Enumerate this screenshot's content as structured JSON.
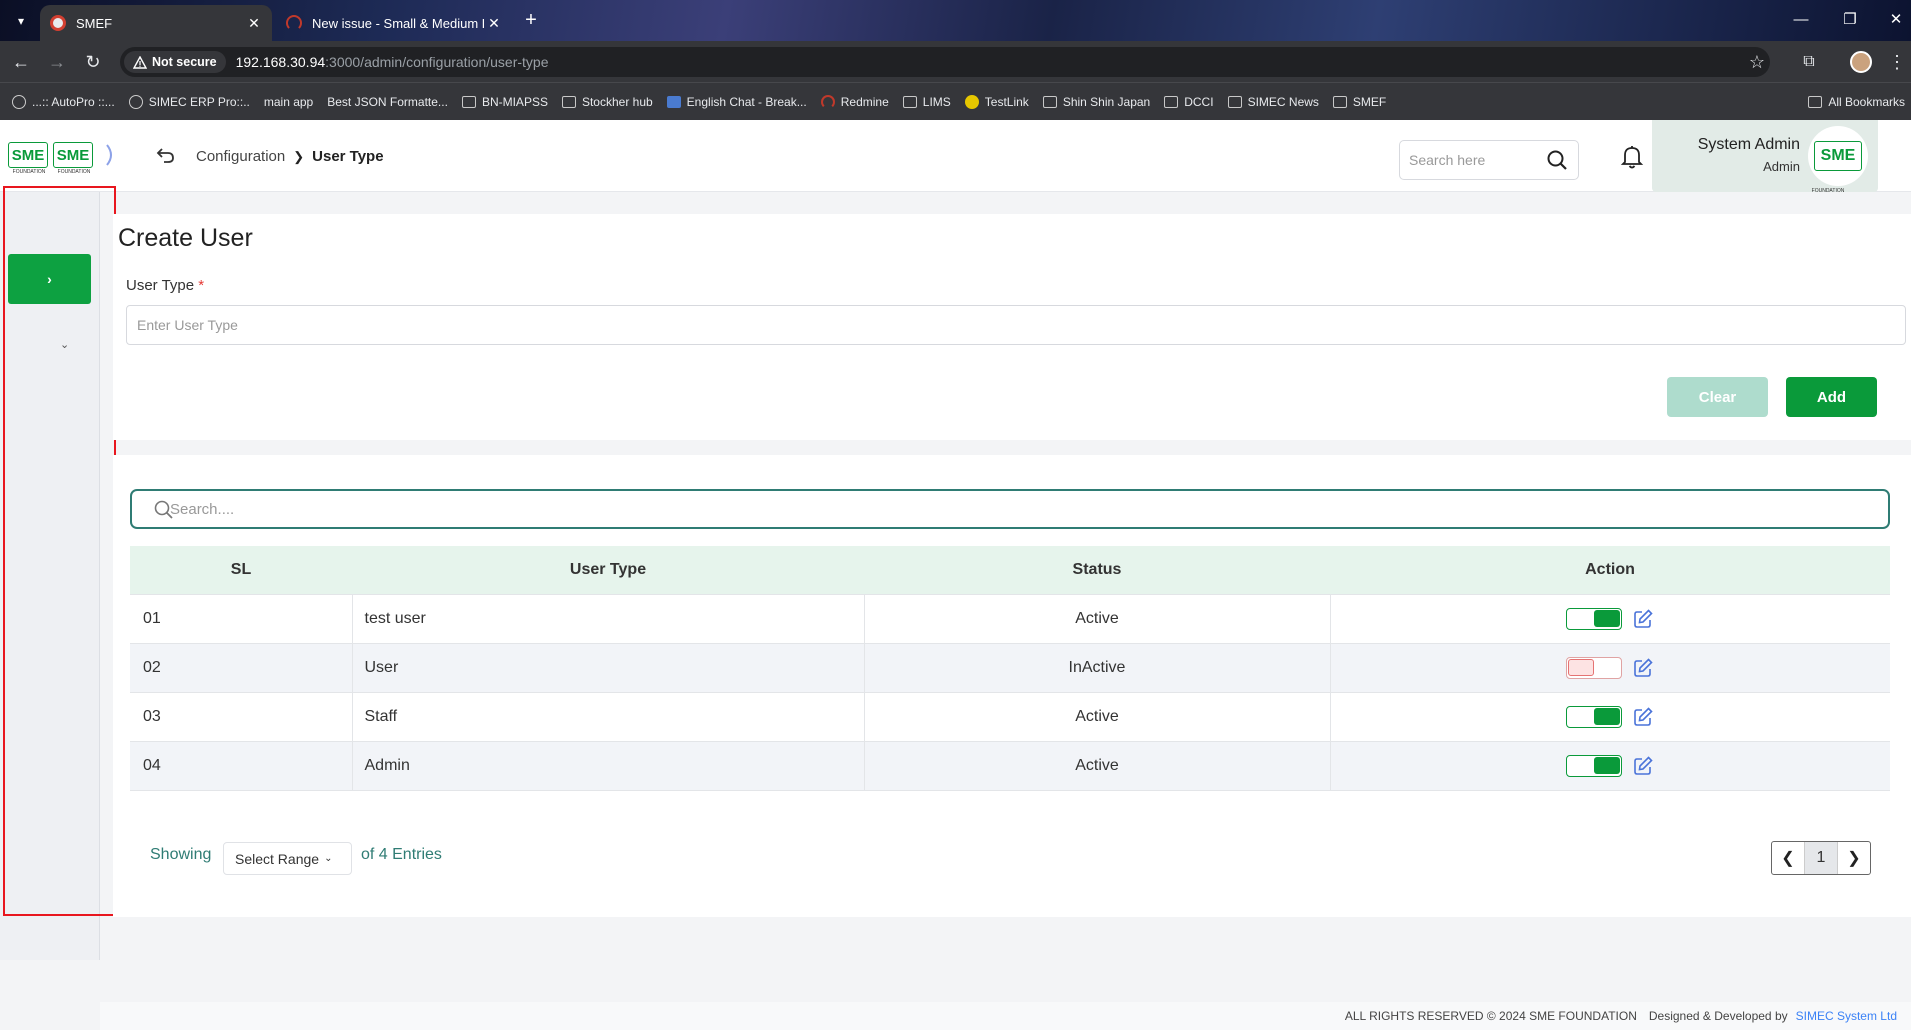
{
  "browser": {
    "tabs": [
      {
        "title": "SMEF"
      },
      {
        "title": "New issue - Small & Medium E"
      }
    ],
    "security_label": "Not secure",
    "url_host": "192.168.30.94",
    "url_path": ":3000/admin/configuration/user-type",
    "bookmarks": [
      {
        "label": "...:: AutoPro ::..."
      },
      {
        "label": "SIMEC ERP Pro::.."
      },
      {
        "label": "main app"
      },
      {
        "label": "Best JSON Formatte..."
      },
      {
        "label": "BN-MIAPSS"
      },
      {
        "label": "Stockher hub"
      },
      {
        "label": "English Chat - Break..."
      },
      {
        "label": "Redmine"
      },
      {
        "label": "LIMS"
      },
      {
        "label": "TestLink"
      },
      {
        "label": "Shin Shin Japan"
      },
      {
        "label": "DCCI"
      },
      {
        "label": "SIMEC News"
      },
      {
        "label": "SMEF"
      }
    ],
    "all_bookmarks": "All Bookmarks"
  },
  "header": {
    "logo_text": "SME",
    "logo_caption": "FOUNDATION",
    "breadcrumb": {
      "parent": "Configuration",
      "current": "User Type"
    },
    "search_placeholder": "Search here",
    "profile": {
      "name": "System Admin",
      "role": "Admin"
    }
  },
  "form": {
    "title": "Create User",
    "field_label": "User Type",
    "required_mark": "*",
    "field_placeholder": "Enter User Type",
    "field_value": "",
    "clear_label": "Clear",
    "add_label": "Add"
  },
  "table": {
    "search_placeholder": "Search....",
    "headers": {
      "sl": "SL",
      "type": "User Type",
      "status": "Status",
      "action": "Action"
    },
    "rows": [
      {
        "sl": "01",
        "type": "test user",
        "status": "Active",
        "enabled": true
      },
      {
        "sl": "02",
        "type": "User",
        "status": "InActive",
        "enabled": false
      },
      {
        "sl": "03",
        "type": "Staff",
        "status": "Active",
        "enabled": true
      },
      {
        "sl": "04",
        "type": "Admin",
        "status": "Active",
        "enabled": true
      }
    ],
    "showing_label": "Showing",
    "range_label": "Select Range",
    "entries_label": "of 4 Entries",
    "current_page": "1"
  },
  "footer": {
    "rights": "ALL RIGHTS RESERVED © 2024 SME FOUNDATION",
    "designed": "Designed & Developed by",
    "company": "SIMEC System Ltd"
  },
  "colors": {
    "primary_green": "#0a9a3a",
    "inactive_red": "#e53935",
    "highlight_red": "#e8161e",
    "teal": "#2f7c74"
  }
}
